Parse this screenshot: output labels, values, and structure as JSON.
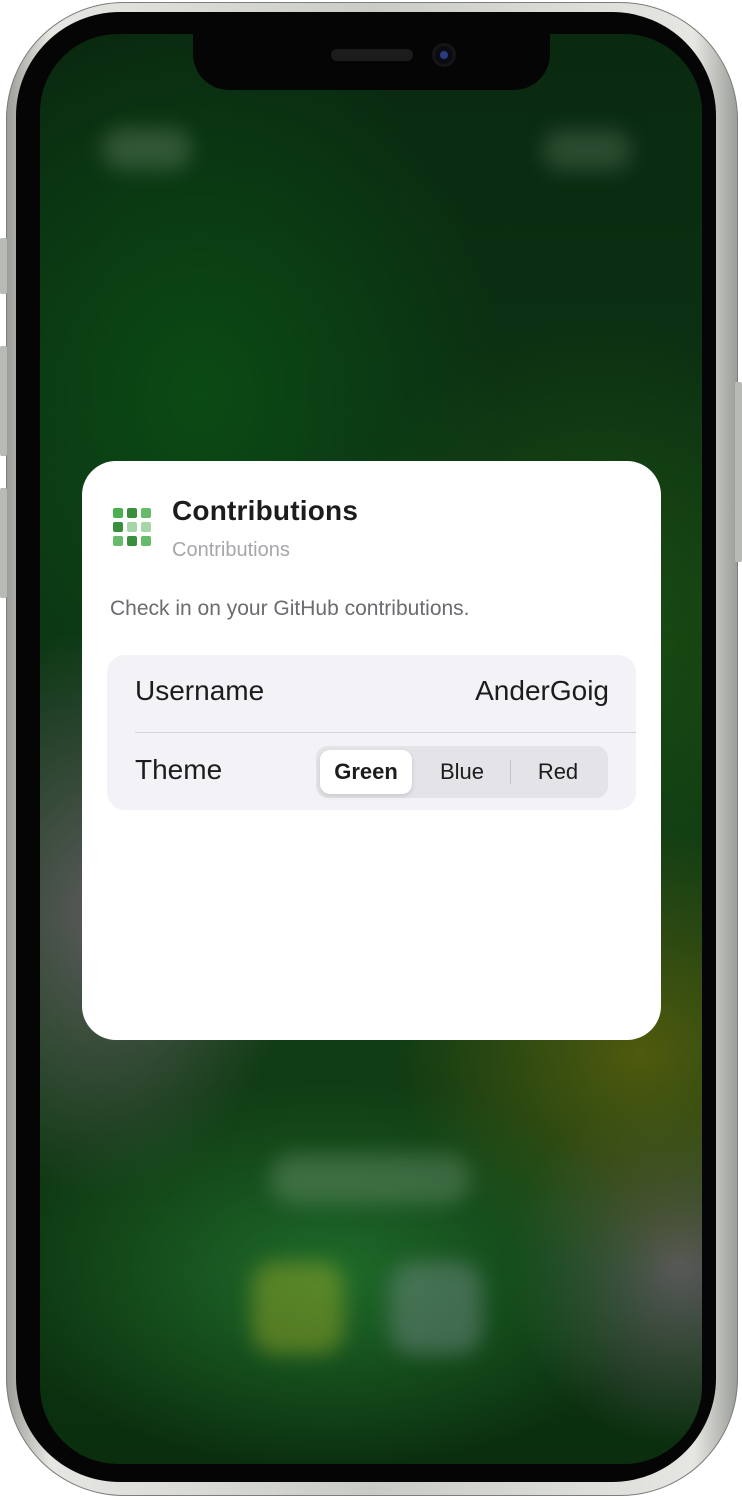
{
  "widget": {
    "title": "Contributions",
    "subtitle": "Contributions",
    "description": "Check in on your GitHub contributions.",
    "icon": "contribution-grid-icon"
  },
  "settings": {
    "username": {
      "label": "Username",
      "value": "AnderGoig"
    },
    "theme": {
      "label": "Theme",
      "options": [
        "Green",
        "Blue",
        "Red"
      ],
      "selected": "Green"
    }
  },
  "colors": {
    "grid_light": "#a5d6a7",
    "grid_mid": "#66bb6a",
    "grid_dark": "#388e3c"
  }
}
